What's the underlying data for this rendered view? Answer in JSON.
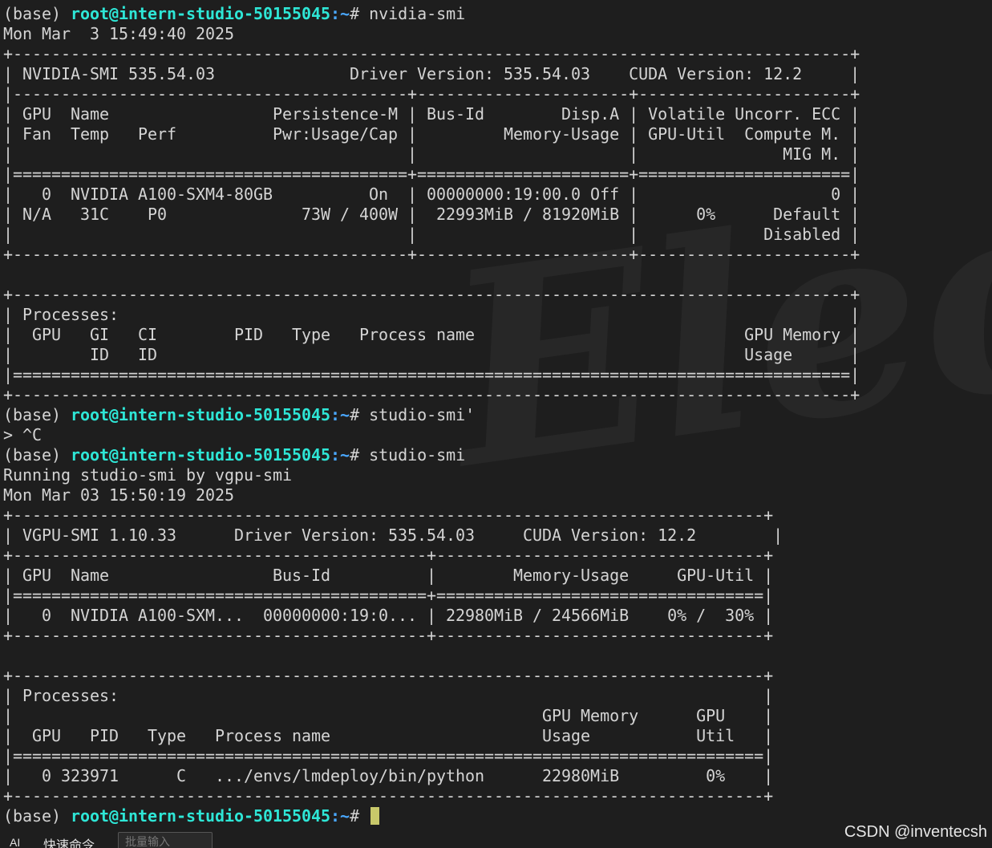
{
  "prompt": {
    "env": "(base) ",
    "user_host": "root@intern-studio-50155045",
    "path": ":~",
    "symbol": "# "
  },
  "lines": [
    {
      "kind": "prompt",
      "cmd": "nvidia-smi"
    },
    {
      "kind": "text",
      "text": "Mon Mar  3 15:49:40 2025"
    },
    {
      "kind": "text",
      "text": "+---------------------------------------------------------------------------------------+"
    },
    {
      "kind": "text",
      "text": "| NVIDIA-SMI 535.54.03              Driver Version: 535.54.03    CUDA Version: 12.2     |"
    },
    {
      "kind": "text",
      "text": "|-----------------------------------------+----------------------+----------------------+"
    },
    {
      "kind": "text",
      "text": "| GPU  Name                 Persistence-M | Bus-Id        Disp.A | Volatile Uncorr. ECC |"
    },
    {
      "kind": "text",
      "text": "| Fan  Temp   Perf          Pwr:Usage/Cap |         Memory-Usage | GPU-Util  Compute M. |"
    },
    {
      "kind": "text",
      "text": "|                                         |                      |               MIG M. |"
    },
    {
      "kind": "text",
      "text": "|=========================================+======================+======================|"
    },
    {
      "kind": "text",
      "text": "|   0  NVIDIA A100-SXM4-80GB          On  | 00000000:19:00.0 Off |                    0 |"
    },
    {
      "kind": "text",
      "text": "| N/A   31C    P0              73W / 400W |  22993MiB / 81920MiB |      0%      Default |"
    },
    {
      "kind": "text",
      "text": "|                                         |                      |             Disabled |"
    },
    {
      "kind": "text",
      "text": "+-----------------------------------------+----------------------+----------------------+"
    },
    {
      "kind": "text",
      "text": ""
    },
    {
      "kind": "text",
      "text": "+---------------------------------------------------------------------------------------+"
    },
    {
      "kind": "text",
      "text": "| Processes:                                                                            |"
    },
    {
      "kind": "text",
      "text": "|  GPU   GI   CI        PID   Type   Process name                            GPU Memory |"
    },
    {
      "kind": "text",
      "text": "|        ID   ID                                                             Usage      |"
    },
    {
      "kind": "text",
      "text": "|=======================================================================================|"
    },
    {
      "kind": "text",
      "text": "+---------------------------------------------------------------------------------------+"
    },
    {
      "kind": "prompt",
      "cmd": "studio-smi'"
    },
    {
      "kind": "text",
      "text": "> ^C"
    },
    {
      "kind": "prompt",
      "cmd": "studio-smi"
    },
    {
      "kind": "text",
      "text": "Running studio-smi by vgpu-smi"
    },
    {
      "kind": "text",
      "text": "Mon Mar 03 15:50:19 2025"
    },
    {
      "kind": "text",
      "text": "+------------------------------------------------------------------------------+"
    },
    {
      "kind": "text",
      "text": "| VGPU-SMI 1.10.33      Driver Version: 535.54.03     CUDA Version: 12.2        |"
    },
    {
      "kind": "text",
      "text": "+-------------------------------------------+----------------------------------+"
    },
    {
      "kind": "text",
      "text": "| GPU  Name                 Bus-Id          |        Memory-Usage     GPU-Util |"
    },
    {
      "kind": "text",
      "text": "|===========================================+==================================|"
    },
    {
      "kind": "text",
      "text": "|   0  NVIDIA A100-SXM...  00000000:19:0... | 22980MiB / 24566MiB    0% /  30% |"
    },
    {
      "kind": "text",
      "text": "+-------------------------------------------+----------------------------------+"
    },
    {
      "kind": "text",
      "text": ""
    },
    {
      "kind": "text",
      "text": "+------------------------------------------------------------------------------+"
    },
    {
      "kind": "text",
      "text": "| Processes:                                                                   |"
    },
    {
      "kind": "text",
      "text": "|                                                       GPU Memory      GPU    |"
    },
    {
      "kind": "text",
      "text": "|  GPU   PID   Type   Process name                      Usage           Util   |"
    },
    {
      "kind": "text",
      "text": "|==============================================================================|"
    },
    {
      "kind": "text",
      "text": "|   0 323971      C   .../envs/lmdeploy/bin/python      22980MiB         0%    |"
    },
    {
      "kind": "text",
      "text": "+------------------------------------------------------------------------------+"
    },
    {
      "kind": "prompt",
      "cmd": "",
      "cursor": true
    }
  ],
  "watermark_text": "Electe",
  "credit": "CSDN @inventecsh",
  "bottom_bar": {
    "ai_label": "AI",
    "quick_label": "快速命令",
    "batch_placeholder": "批量输入"
  },
  "colors": {
    "background": "#1e1e1e",
    "text": "#d4d4d4",
    "user_host": "#2ee6d6",
    "path": "#4aa8ff",
    "cursor": "#c8c86a"
  }
}
